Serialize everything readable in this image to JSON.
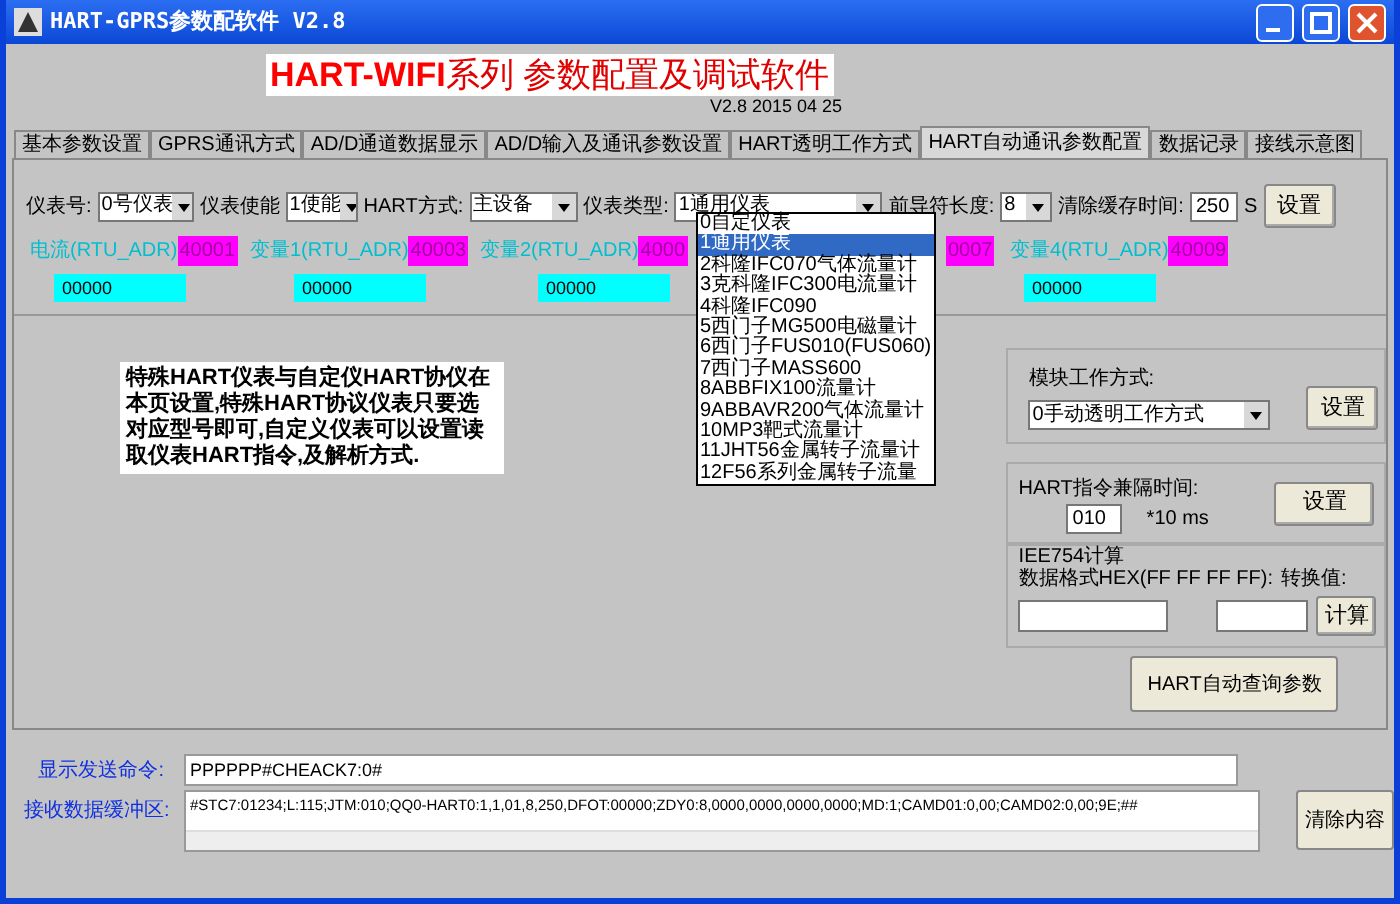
{
  "window": {
    "title": "HART-GPRS参数配软件 V2.8"
  },
  "banner": {
    "title_red": "HART-WIFI",
    "title_rest": "系列 参数配置及调试软件",
    "version": "V2.8 2015 04 25"
  },
  "tabs": [
    {
      "label": "基本参数设置",
      "selected": false
    },
    {
      "label": "GPRS通讯方式",
      "selected": false
    },
    {
      "label": "AD/D通道数据显示",
      "selected": false
    },
    {
      "label": "AD/D输入及通讯参数设置",
      "selected": false
    },
    {
      "label": "HART透明工作方式",
      "selected": false
    },
    {
      "label": "HART自动通讯参数配置",
      "selected": true
    },
    {
      "label": "数据记录",
      "selected": false
    },
    {
      "label": "接线示意图",
      "selected": false
    }
  ],
  "settings_row": {
    "meter_no_label": "仪表号:",
    "meter_no": "0号仪表",
    "enable_label": "仪表使能",
    "enable": "1使能",
    "hart_mode_label": "HART方式:",
    "hart_mode": "主设备",
    "meter_type_label": "仪表类型:",
    "meter_type": "1通用仪表",
    "preamble_label": "前导符长度:",
    "preamble": "8",
    "clear_time_label": "清除缓存时间:",
    "clear_time": "250",
    "clear_time_unit": "S",
    "set_button": "设置"
  },
  "variables": [
    {
      "label": "电流(RTU_ADR)",
      "address": "40001",
      "value": "00000"
    },
    {
      "label": "变量1(RTU_ADR)",
      "address": "40003",
      "value": "00000"
    },
    {
      "label": "变量2(RTU_ADR)",
      "address": "4000",
      "value": "00000"
    },
    {
      "address": "0007"
    },
    {
      "label": "变量4(RTU_ADR)",
      "address": "40009",
      "value": "00000"
    }
  ],
  "meter_type_options": [
    {
      "label": "0自定仪表",
      "selected": false
    },
    {
      "label": "1通用仪表",
      "selected": true
    },
    {
      "label": "2科隆IFC070气体流量计",
      "selected": false
    },
    {
      "label": "3克科隆IFC300电流量计",
      "selected": false
    },
    {
      "label": "4科隆IFC090",
      "selected": false
    },
    {
      "label": "5西门子MG500电磁量计",
      "selected": false
    },
    {
      "label": "6西门子FUS010(FUS060)",
      "selected": false
    },
    {
      "label": "7西门子MASS600",
      "selected": false
    },
    {
      "label": "8ABBFIX100流量计",
      "selected": false
    },
    {
      "label": "9ABBAVR200气体流量计",
      "selected": false
    },
    {
      "label": "10MP3靶式流量计",
      "selected": false
    },
    {
      "label": "11JHT56金属转子流量计",
      "selected": false
    },
    {
      "label": "12F56系列金属转子流量",
      "selected": false
    }
  ],
  "note": "特殊HART仪表与自定仪HART协仪在本页设置,特殊HART协议仪表只要选对应型号即可,自定义仪表可以设置读取仪表HART指令,及解析方式.",
  "module_mode": {
    "label": "模块工作方式:",
    "value": "0手动透明工作方式",
    "button": "设置"
  },
  "interval": {
    "label": "HART指令兼隔时间:",
    "value": "010",
    "unit": "*10 ms",
    "button": "设置"
  },
  "ieee754": {
    "title": "IEE754计算",
    "format_label": "数据格式HEX(FF FF FF FF):",
    "result_label": "转换值:",
    "button": "计算"
  },
  "auto_query_button": "HART自动查询参数",
  "send_command": {
    "label": "显示发送命令:",
    "value": "PPPPPP#CHEACK7:0#"
  },
  "receive_buffer": {
    "label": "接收数据缓冲区:",
    "value": "#STC7:01234;L:115;JTM:010;QQ0-HART0:1,1,01,8,250,DFOT:00000;ZDY0:8,0000,0000,0000,0000;MD:1;CAMD01:0,00;CAMD02:0,00;9E;##",
    "button": "清除内容"
  }
}
